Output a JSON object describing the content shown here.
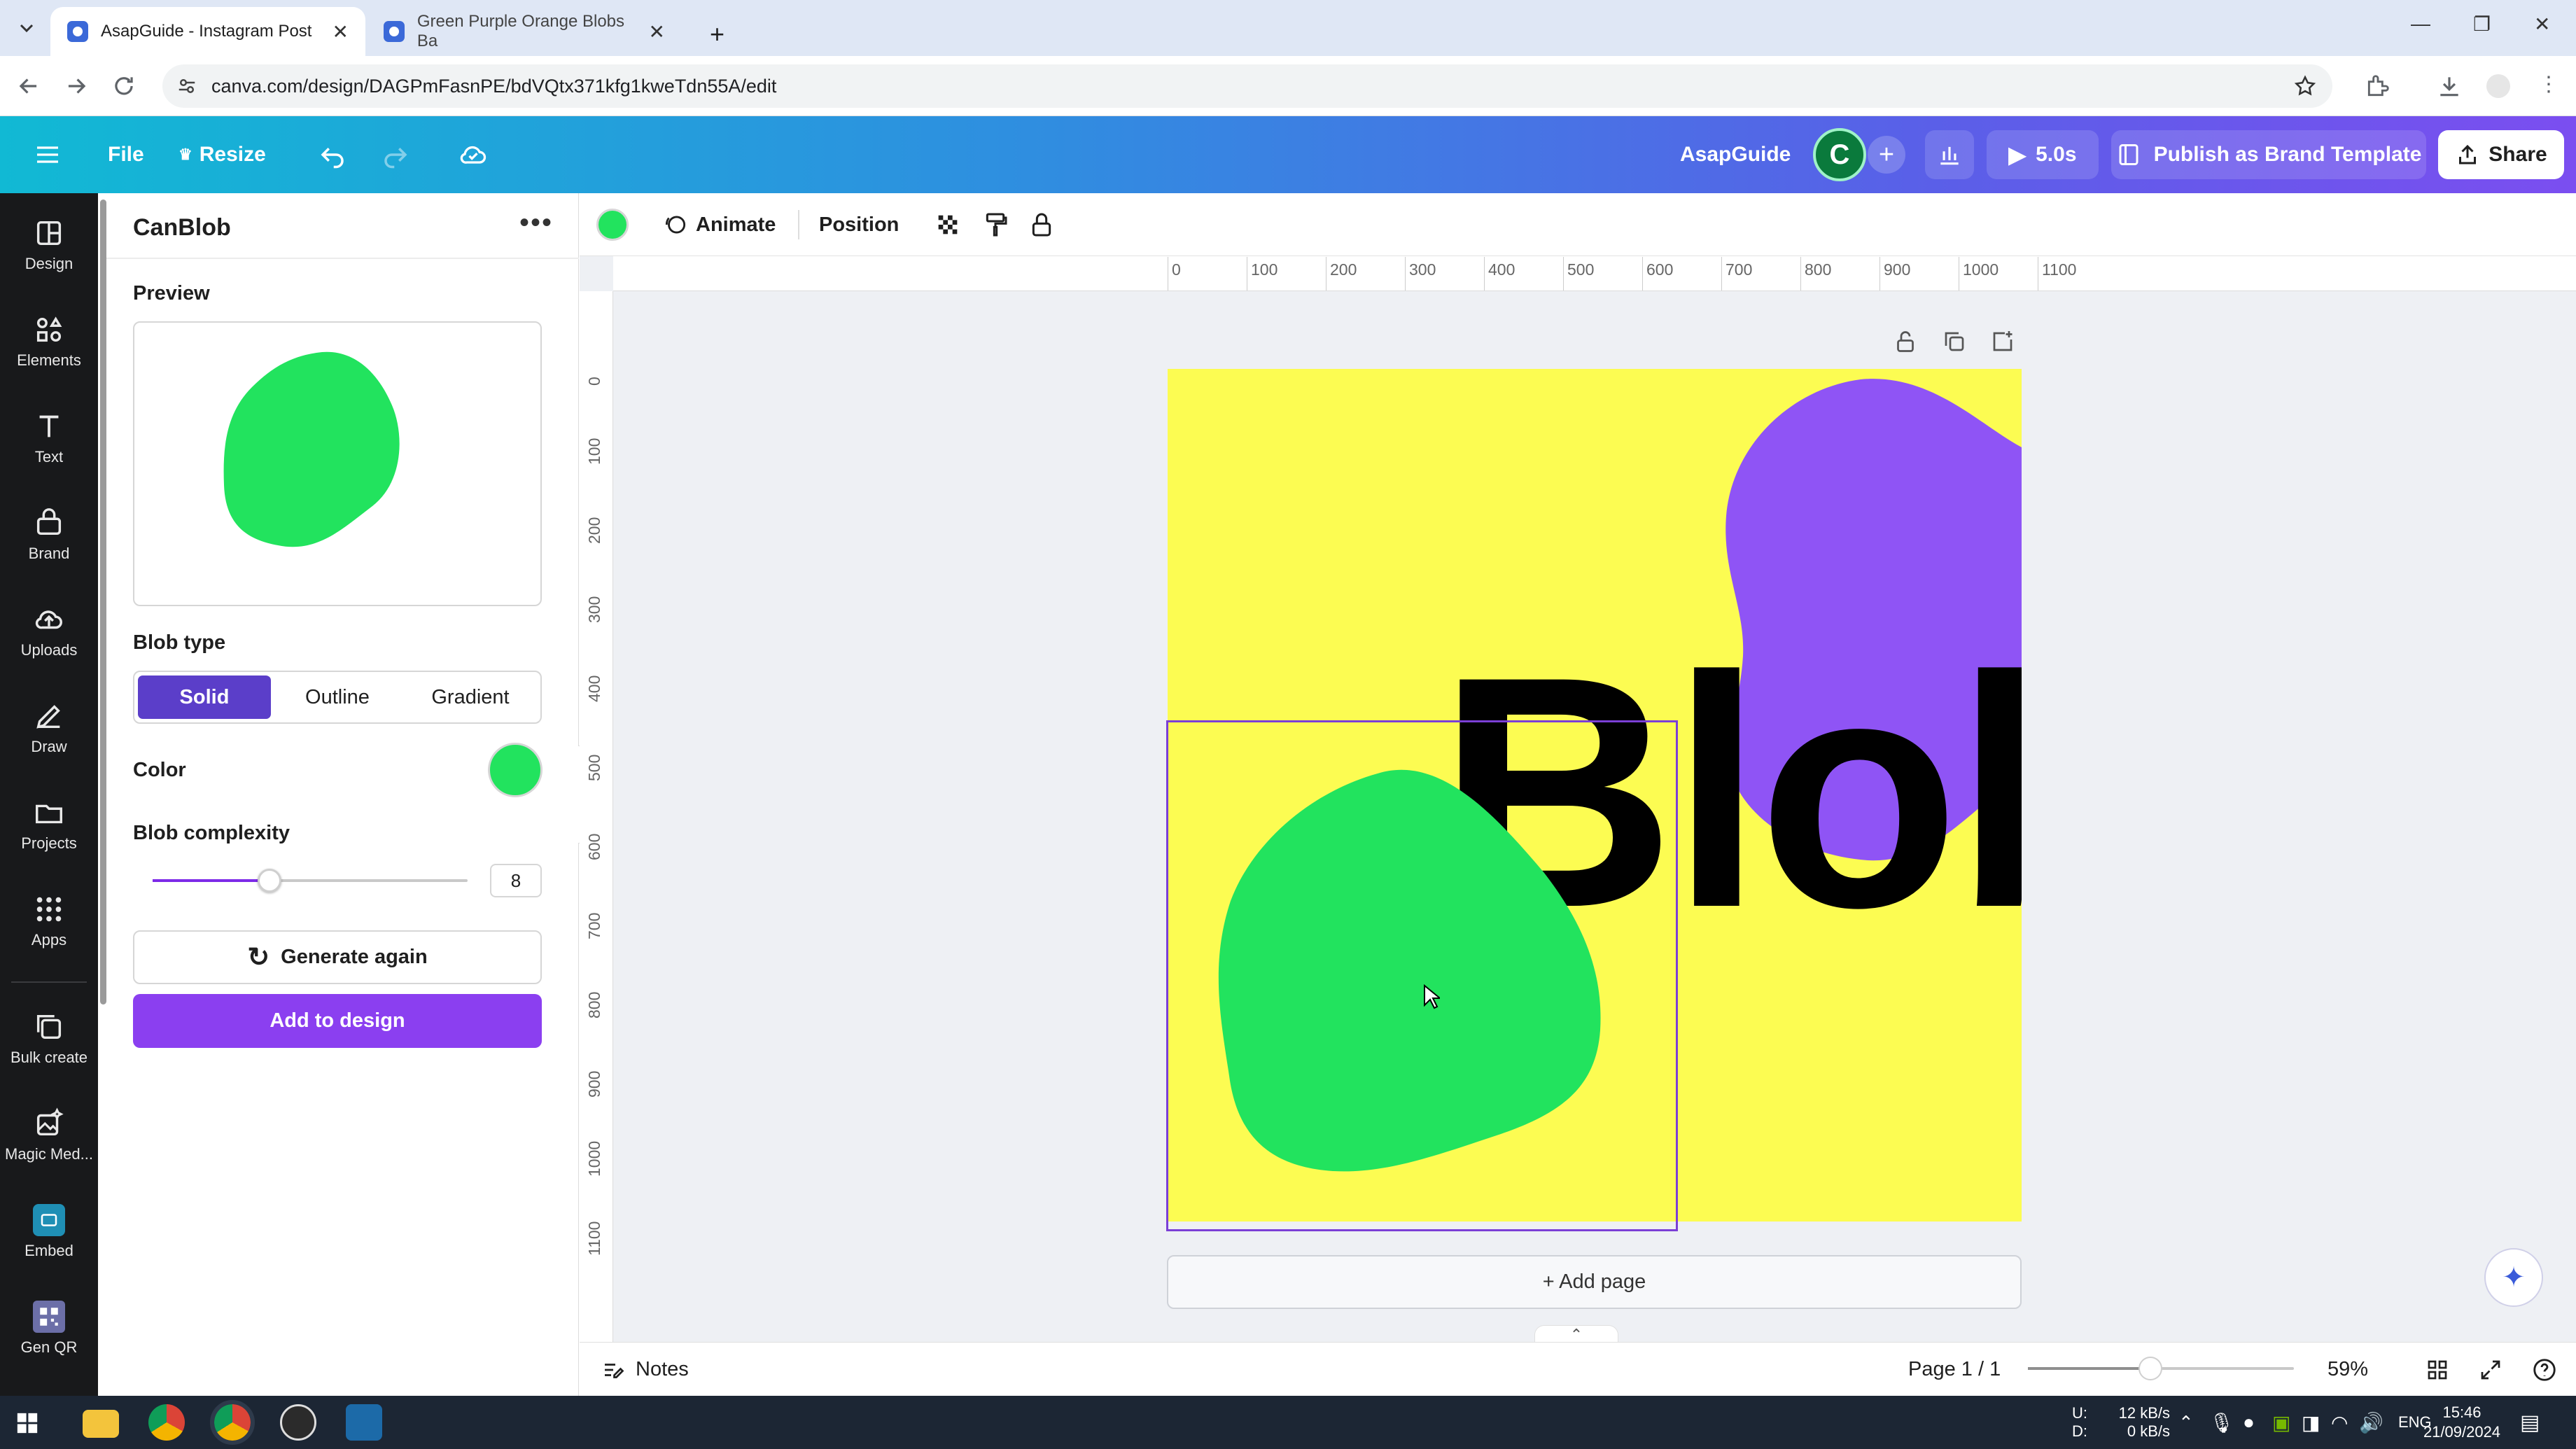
{
  "browser": {
    "tabs": [
      {
        "title": "AsapGuide - Instagram Post",
        "active": true
      },
      {
        "title": "Green Purple Orange Blobs Ba",
        "active": false
      }
    ],
    "new_tab": "+",
    "url": "canva.com/design/DAGPmFasnPE/bdVQtx371kfg1kweTdn55A/edit"
  },
  "header": {
    "file": "File",
    "resize": "Resize",
    "team": "AsapGuide",
    "avatar": "C",
    "add": "+",
    "timer": "5.0s",
    "publish": "Publish as Brand Template",
    "share": "Share"
  },
  "rail": [
    {
      "label": "Design",
      "icon": "design-icon"
    },
    {
      "label": "Elements",
      "icon": "elements-icon"
    },
    {
      "label": "Text",
      "icon": "text-icon"
    },
    {
      "label": "Brand",
      "icon": "brand-icon"
    },
    {
      "label": "Uploads",
      "icon": "uploads-icon"
    },
    {
      "label": "Draw",
      "icon": "draw-icon"
    },
    {
      "label": "Projects",
      "icon": "projects-icon"
    },
    {
      "label": "Apps",
      "icon": "apps-icon"
    },
    {
      "label": "Bulk create",
      "icon": "bulk-create-icon"
    },
    {
      "label": "Magic Med...",
      "icon": "magic-media-icon"
    },
    {
      "label": "Embed",
      "icon": "embed-icon"
    },
    {
      "label": "Gen QR",
      "icon": "qr-code-icon"
    }
  ],
  "panel": {
    "title": "CanBlob",
    "more": "•••",
    "preview_label": "Preview",
    "blob_type_label": "Blob type",
    "blob_types": [
      "Solid",
      "Outline",
      "Gradient"
    ],
    "selected_type": "Solid",
    "color_label": "Color",
    "color_value": "#22e35e",
    "complexity_label": "Blob complexity",
    "complexity": 8,
    "complexity_fraction": 0.37,
    "generate": "Generate again",
    "add": "Add to design"
  },
  "toolbar": {
    "animate": "Animate",
    "position": "Position"
  },
  "rulers": {
    "horizontal": [
      "0",
      "100",
      "200",
      "300",
      "400",
      "500",
      "600",
      "700",
      "800",
      "900",
      "1000",
      "1100"
    ],
    "vertical": [
      "0",
      "100",
      "200",
      "300",
      "400",
      "500",
      "600",
      "700",
      "800",
      "900",
      "1000",
      "1100"
    ]
  },
  "canvas": {
    "background": "#fcfc52",
    "heading": "Blob",
    "blob_colors": {
      "green": "#22e35e",
      "purple": "#8f54f5"
    },
    "add_page": "+ Add page"
  },
  "footer": {
    "notes": "Notes",
    "page": "Page 1 / 1",
    "zoom": "59%",
    "zoom_fraction": 0.46
  },
  "taskbar": {
    "net_up": "12 kB/s",
    "net_down": "0 kB/s",
    "net_up_label": "U:",
    "net_down_label": "D:",
    "lang": "ENG",
    "time": "15:46",
    "date": "21/09/2024"
  }
}
